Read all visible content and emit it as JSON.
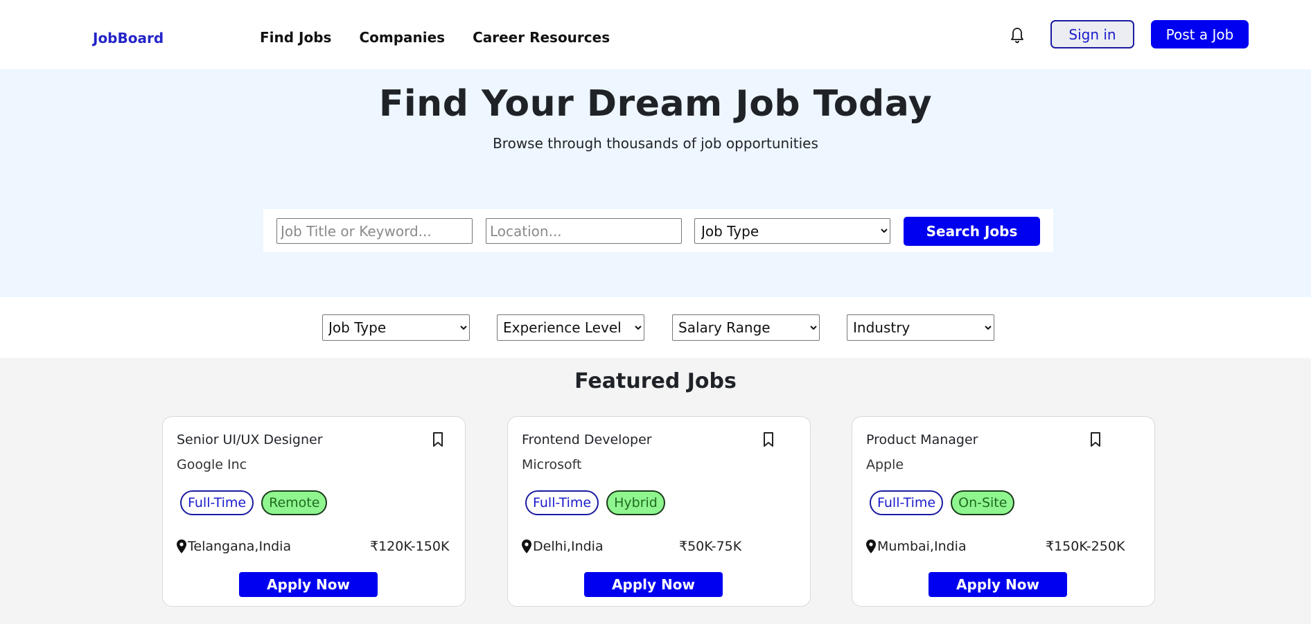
{
  "header": {
    "brand": "JobBoard",
    "nav": [
      "Find Jobs",
      "Companies",
      "Career Resources"
    ],
    "notification_icon": "bell-icon",
    "signin_label": "Sign in",
    "post_label": "Post a Job"
  },
  "hero": {
    "title": "Find Your Dream Job Today",
    "subtitle": "Browse through thousands of job opportunities",
    "search": {
      "keyword_placeholder": "Job Title or Keyword...",
      "location_placeholder": "Location...",
      "job_type_selected": "Job Type",
      "button_label": "Search Jobs"
    }
  },
  "filters": {
    "job_type": "Job Type",
    "experience": "Experience Level",
    "salary": "Salary Range",
    "industry": "Industry"
  },
  "featured": {
    "title": "Featured Jobs",
    "jobs": [
      {
        "title": "Senior UI/UX Designer",
        "company": "Google Inc",
        "employment": "Full-Time",
        "mode": "Remote",
        "location": "Telangana,India",
        "salary": "₹120K-150K",
        "apply": "Apply Now"
      },
      {
        "title": "Frontend Developer",
        "company": "Microsoft",
        "employment": "Full-Time",
        "mode": "Hybrid",
        "location": "Delhi,India",
        "salary": "₹50K-75K",
        "apply": "Apply Now"
      },
      {
        "title": "Product Manager",
        "company": "Apple",
        "employment": "Full-Time",
        "mode": "On-Site",
        "location": "Mumbai,India",
        "salary": "₹150K-250K",
        "apply": "Apply Now"
      }
    ]
  },
  "colors": {
    "brand": "#2424c8",
    "primary_button": "#0000f0",
    "hero_bg": "#eef6ff",
    "tag_green_bg": "#8ff58f"
  }
}
